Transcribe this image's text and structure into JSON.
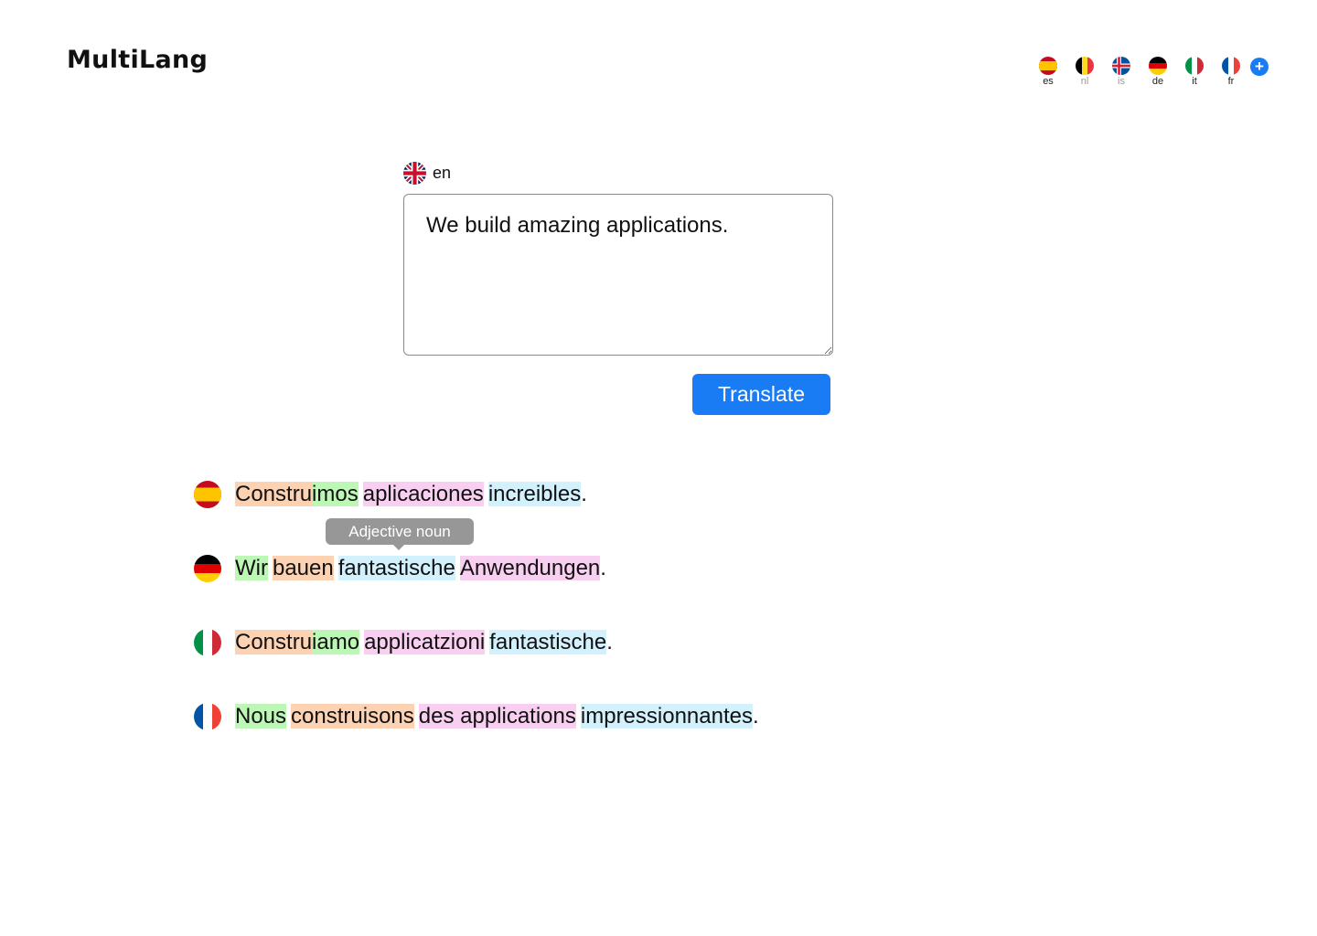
{
  "app": {
    "title": "MultiLang"
  },
  "target_languages": [
    {
      "code": "es",
      "flag": "es-flag-icon",
      "active": true
    },
    {
      "code": "nl",
      "flag": "be-flag-icon",
      "active": false
    },
    {
      "code": "is",
      "flag": "is-flag-icon",
      "active": false
    },
    {
      "code": "de",
      "flag": "de-flag-icon",
      "active": true
    },
    {
      "code": "it",
      "flag": "it-flag-icon",
      "active": true
    },
    {
      "code": "fr",
      "flag": "fr-flag-icon",
      "active": true
    }
  ],
  "add_language": {
    "icon": "plus-icon",
    "label": "+"
  },
  "source": {
    "code": "en",
    "flag": "uk-flag-icon",
    "text": "We build amazing applications."
  },
  "translate_button": {
    "label": "Translate"
  },
  "tooltip": {
    "text": "Adjective noun"
  },
  "results": [
    {
      "code": "es",
      "tokens": [
        {
          "t": "Constru",
          "c": "orange"
        },
        {
          "t": "imos",
          "c": "green",
          "join": true
        },
        {
          "t": "aplicaciones",
          "c": "pink"
        },
        {
          "t": "increibles",
          "c": "blue"
        }
      ],
      "punct": "."
    },
    {
      "code": "de",
      "tokens": [
        {
          "t": "Wir",
          "c": "green"
        },
        {
          "t": "bauen",
          "c": "orange"
        },
        {
          "t": "fantastische",
          "c": "blue"
        },
        {
          "t": "Anwendungen",
          "c": "pink"
        }
      ],
      "punct": "."
    },
    {
      "code": "it",
      "tokens": [
        {
          "t": "Constru",
          "c": "orange"
        },
        {
          "t": "iamo",
          "c": "green",
          "join": true
        },
        {
          "t": "applicatzioni",
          "c": "pink"
        },
        {
          "t": "fantastische",
          "c": "blue"
        }
      ],
      "punct": "."
    },
    {
      "code": "fr",
      "tokens": [
        {
          "t": "Nous",
          "c": "green"
        },
        {
          "t": "construisons",
          "c": "orange"
        },
        {
          "t": "des applications",
          "c": "pink"
        },
        {
          "t": "impressionnantes",
          "c": "blue"
        }
      ],
      "punct": "."
    }
  ],
  "colors": {
    "accent": "#1a7cf5",
    "orange": "#fdd2b3",
    "green": "#bdf7b5",
    "pink": "#f9cff1",
    "blue": "#d2f1fc",
    "tooltip": "#979797"
  }
}
